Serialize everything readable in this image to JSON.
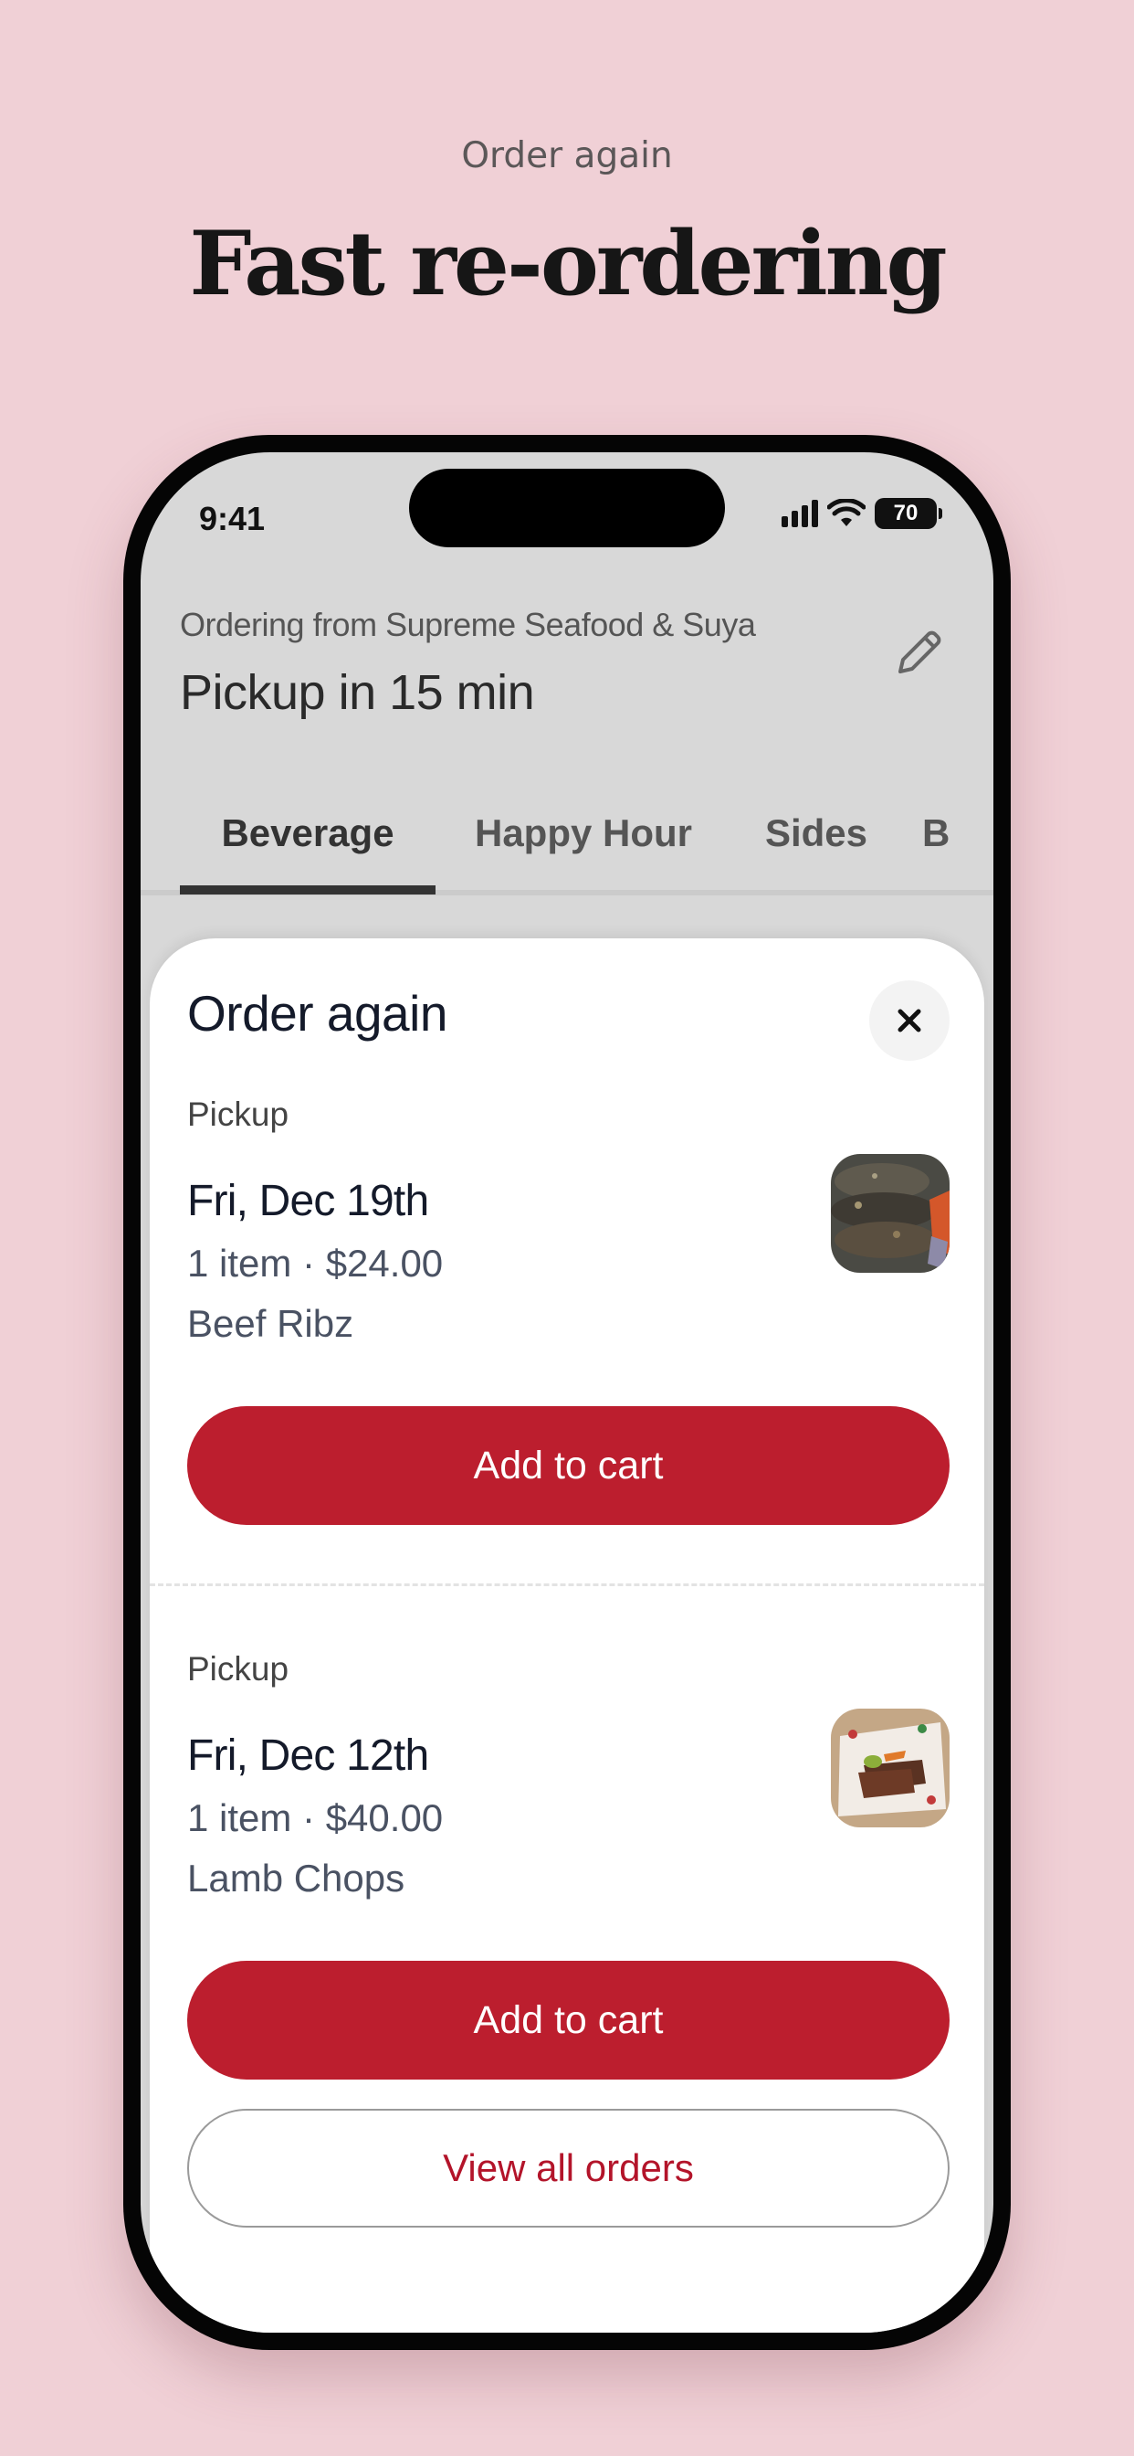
{
  "promo": {
    "eyebrow": "Order again",
    "headline": "Fast re-ordering"
  },
  "status_bar": {
    "time": "9:41",
    "battery": "70",
    "icons": [
      "signal-icon",
      "wifi-icon",
      "battery-icon"
    ]
  },
  "header": {
    "subtitle": "Ordering from Supreme Seafood & Suya",
    "title": "Pickup in 15 min",
    "edit_icon": "pencil-icon"
  },
  "tabs": [
    {
      "label": "Beverage",
      "active": true
    },
    {
      "label": "Happy Hour",
      "active": false
    },
    {
      "label": "Sides",
      "active": false
    },
    {
      "label": "B",
      "active": false
    }
  ],
  "sheet": {
    "title": "Order again",
    "close_icon": "close-icon",
    "orders": [
      {
        "mode": "Pickup",
        "date": "Fri, Dec 19th",
        "summary": "1 item · $24.00",
        "item": "Beef Ribz",
        "button": "Add to cart"
      },
      {
        "mode": "Pickup",
        "date": "Fri, Dec 12th",
        "summary": "1 item · $40.00",
        "item": "Lamb Chops",
        "button": "Add to cart"
      }
    ],
    "view_all": "View all orders"
  },
  "colors": {
    "background": "#f0d0d6",
    "accent": "#bc1e2e",
    "link": "#b3142a"
  }
}
